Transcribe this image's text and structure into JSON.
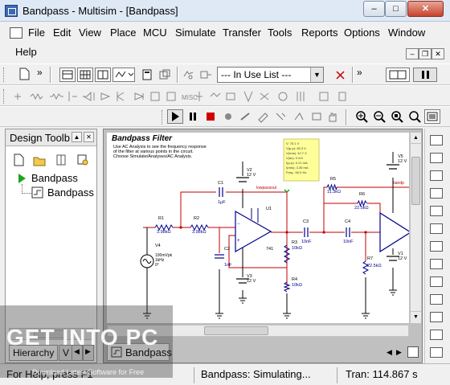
{
  "window": {
    "title": "Bandpass - Multisim - [Bandpass]",
    "min": "–",
    "max": "□",
    "close": "✕"
  },
  "menu": {
    "items": [
      "File",
      "Edit",
      "View",
      "Place",
      "MCU",
      "Simulate",
      "Transfer",
      "Tools",
      "Reports",
      "Options",
      "Window",
      "Help"
    ],
    "mdi": {
      "min": "–",
      "restore": "❐",
      "close": "✕"
    }
  },
  "toolbar": {
    "in_use_list": "--- In Use List ---",
    "chevrons": "»"
  },
  "design_toolbox": {
    "title": "Design Toolb",
    "tree": {
      "root": "Bandpass",
      "child": "Bandpass"
    },
    "tabs": {
      "hierarchy": "Hierarchy",
      "visibility": "V"
    }
  },
  "document_tab": "Bandpass",
  "schematic": {
    "title": "Bandpass Filter",
    "description": [
      "Use AC Analysis to see the frequency response",
      "of the filter at various points in the circuit.",
      "Choose Simulate/Analyses/AC Analysis."
    ],
    "probe": [
      "V: 75.1 V",
      "V(p-p): 83.3 V",
      "V(rms): 42.7 V",
      "V(dc): 0 mV",
      "I(p-p): 0.21 mA",
      "I(rms): 3.35 mA",
      "Freq.: 60.0 Hz"
    ],
    "net_label": "lowpassout",
    "net_label2": "bandp",
    "components": {
      "v2": "V2",
      "v2_val": "12 V",
      "v3": "V3",
      "v3_val": "12 V",
      "v5": "V5",
      "v5_val": "12 V",
      "v1": "V1",
      "v1_val": "12 V",
      "v4": "V4",
      "v4_val": [
        "100mVpk",
        "1kHz",
        "0°"
      ],
      "r1": "R1",
      "r1_val": "3.98kΩ",
      "r2": "R2",
      "r2_val": "3.98kΩ",
      "r3": "R3",
      "r3_val": "10kΩ",
      "r4": "R4",
      "r4_val": "10kΩ",
      "r5": "R5",
      "r5_val": "11.3kΩ",
      "r6": "R6",
      "r6_val": "22.5kΩ",
      "r7": "R7",
      "r7_val": "22.5kΩ",
      "c1": "C1",
      "c1_val": "1µF",
      "c2": "C2",
      "c2_val": "1nF",
      "c3": "C3",
      "c3_val": "10nF",
      "c4": "C4",
      "c4_val": "10nF",
      "u1": "U1",
      "u1_part": "741"
    }
  },
  "status": {
    "help": "For Help, press F1",
    "sim": "Bandpass: Simulating...",
    "tran": "Tran: 114.867 s"
  },
  "watermark": {
    "text": "GET INTO PC",
    "sub": "Download Latest Software for Free"
  },
  "colors": {
    "wire_red": "#c00000",
    "wire_dark": "#000000",
    "component_blue": "#00008b",
    "probe_yellow": "#ffff99",
    "green_play": "#1aa61a"
  }
}
